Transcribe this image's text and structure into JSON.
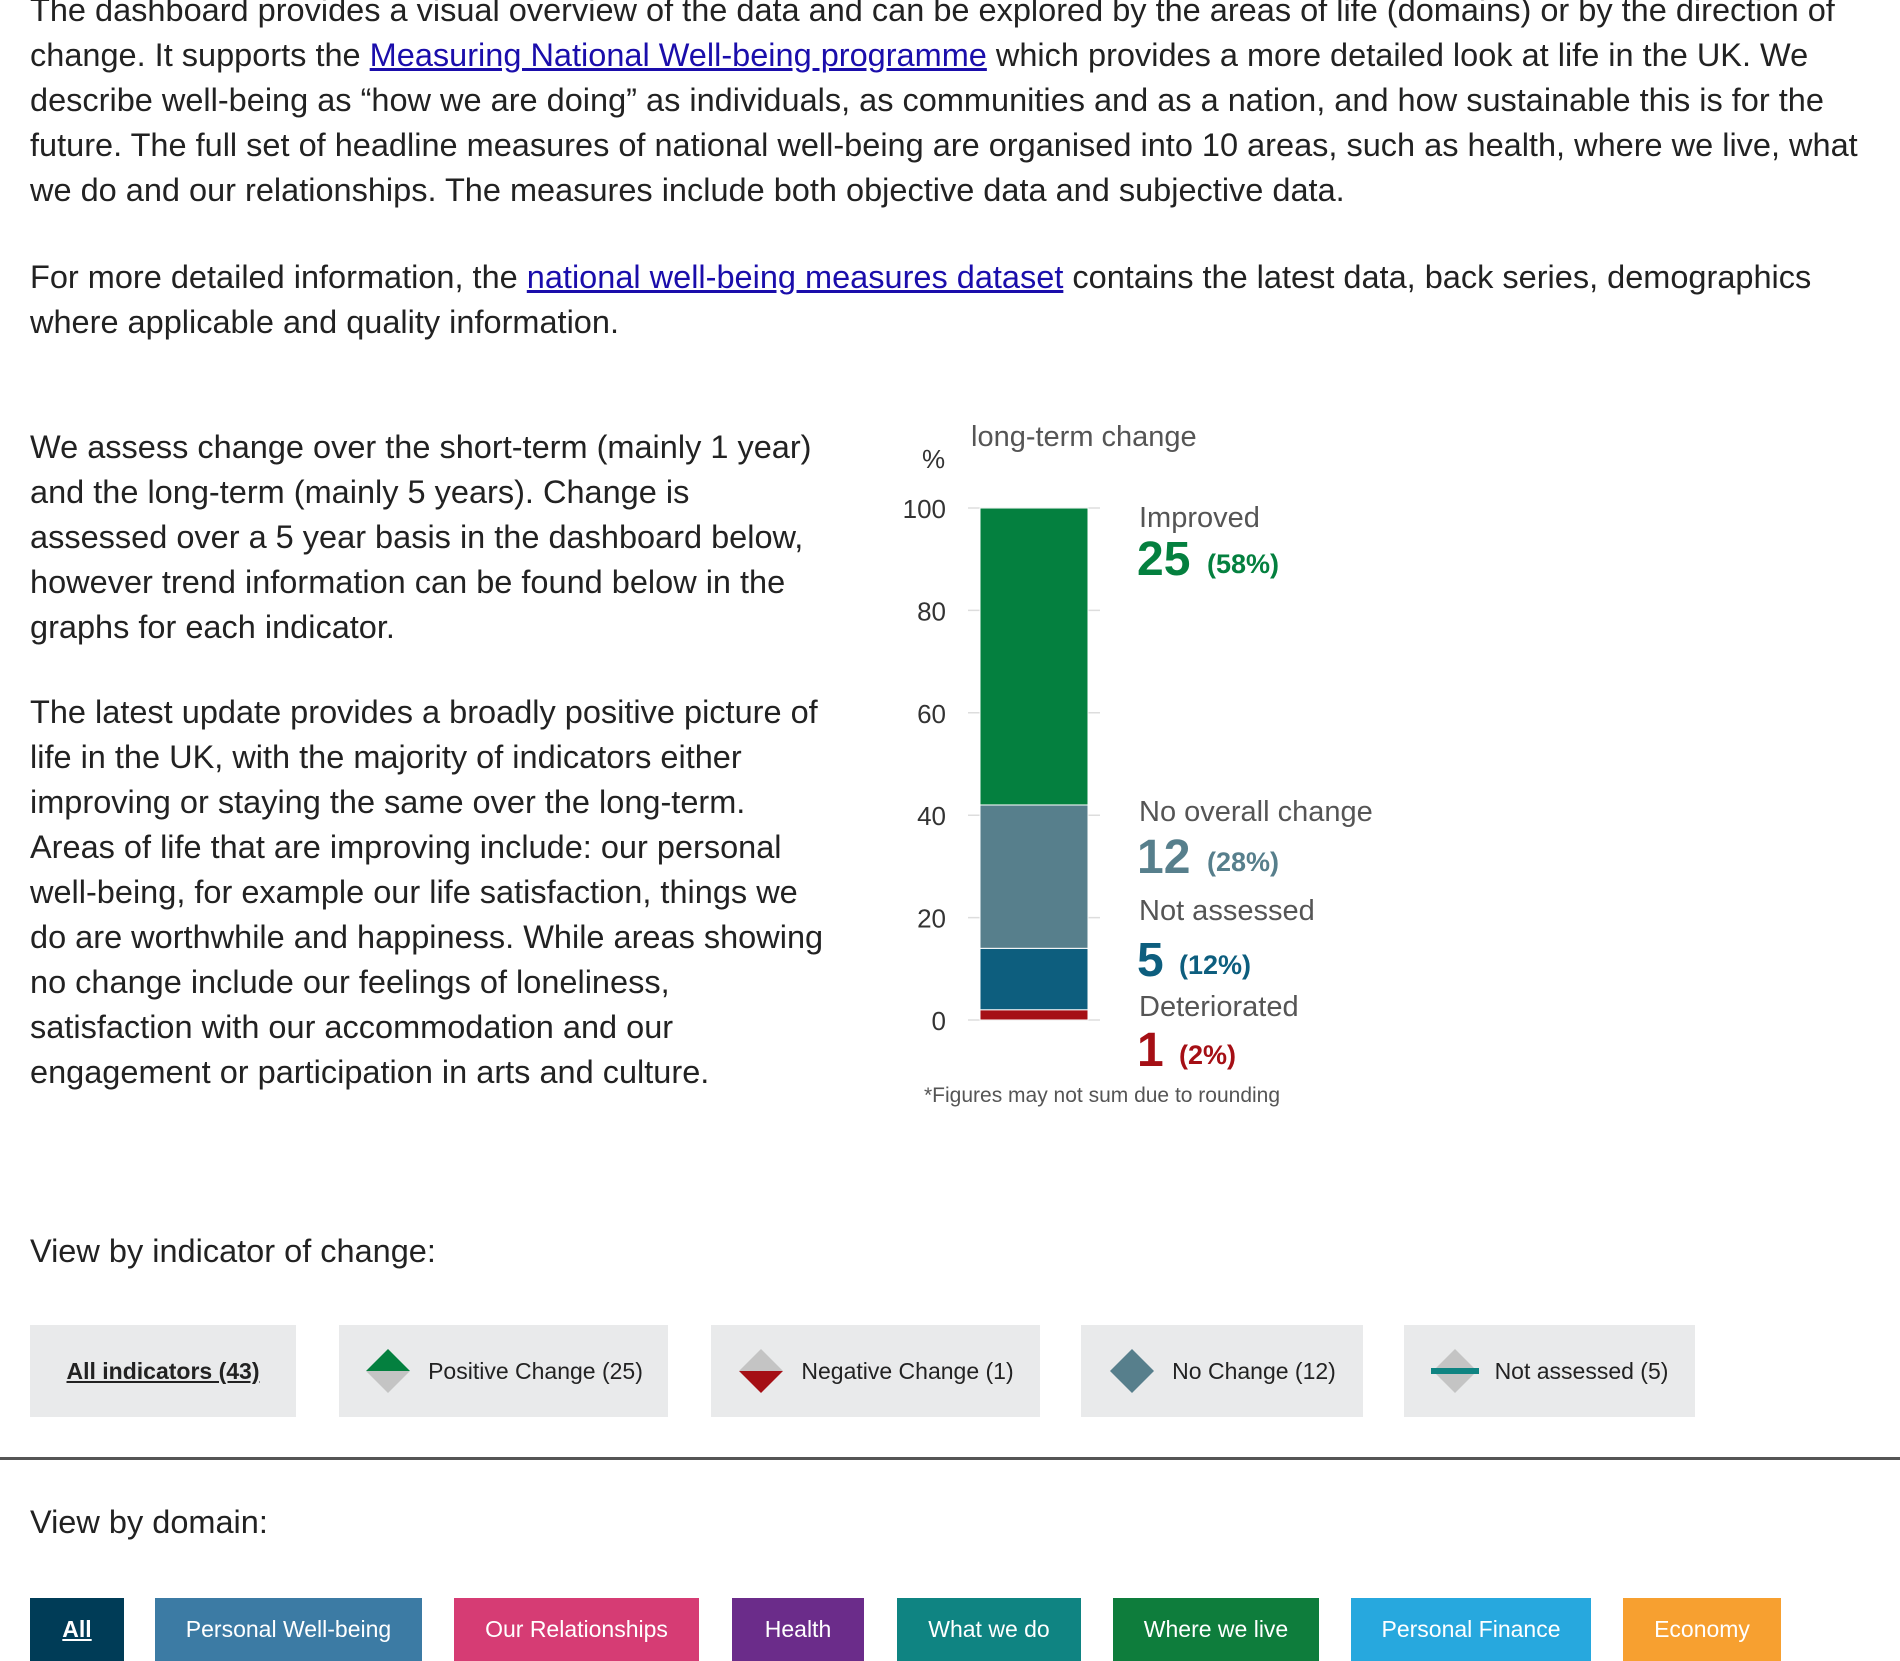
{
  "intro": {
    "p1_a": "The dashboard provides a visual overview of the data and can be explored by the areas of life (domains) or by the direction of change. It supports the ",
    "p1_link": "Measuring National Well-being programme",
    "p1_b": " which provides a more detailed look at life in the UK. We describe well-being as “how we are doing” as individuals, as communities and as a nation, and how sustainable this is for the future. The full set of headline measures of national well-being are organised into 10 areas, such as health, where we live, what we do and our relationships. The measures include both objective data and subjective data.",
    "p2_a": "For more detailed information, the ",
    "p2_link": "national well-being measures dataset",
    "p2_b": " contains the latest data, back series, demographics where applicable and quality information."
  },
  "summary": {
    "p1": "We assess change over the short-term (mainly 1 year) and the long-term (mainly 5 years). Change is assessed over a 5 year basis in the dashboard below, however trend information can be found below in the graphs for each indicator.",
    "p2": "The latest update provides a broadly positive picture of life in the UK, with the majority of indicators either improving or staying the same over the long-term. Areas of life that are improving include: our personal well-being, for example our life satisfaction, things we do are worthwhile and happiness. While areas showing no change include our feelings of loneliness, satisfaction with our accommodation and our engagement or participation in arts and culture."
  },
  "chart_data": {
    "type": "bar",
    "title": "long-term change",
    "ylabel": "%",
    "ylim": [
      0,
      100
    ],
    "yticks": [
      "0",
      "20",
      "40",
      "60",
      "80",
      "100"
    ],
    "series": [
      {
        "name": "Deteriorated",
        "count": "1",
        "pct": "(2%)",
        "value": 2,
        "color": "#a50f15"
      },
      {
        "name": "Not assessed",
        "count": "5",
        "pct": "(12%)",
        "value": 12,
        "color": "#0d5e7e"
      },
      {
        "name": "No overall change",
        "count": "12",
        "pct": "(28%)",
        "value": 28,
        "color": "#577f8c"
      },
      {
        "name": "Improved",
        "count": "25",
        "pct": "(58%)",
        "value": 58,
        "color": "#04803f"
      }
    ],
    "footnote": "*Figures may not sum due to rounding"
  },
  "change_filter": {
    "label": "View by indicator of change:",
    "buttons": [
      {
        "label": "All indicators (43)",
        "icon": "none",
        "active": true
      },
      {
        "label": "Positive Change (25)",
        "icon": "positive-change-icon"
      },
      {
        "label": "Negative Change (1)",
        "icon": "negative-change-icon"
      },
      {
        "label": "No Change (12)",
        "icon": "no-change-icon"
      },
      {
        "label": "Not assessed (5)",
        "icon": "not-assessed-icon"
      }
    ]
  },
  "domain_filter": {
    "label": "View by domain:",
    "buttons": [
      {
        "label": "All",
        "color": "#003c57",
        "active": true
      },
      {
        "label": "Personal Well-being",
        "color": "#3c7ba4"
      },
      {
        "label": "Our Relationships",
        "color": "#d63c74"
      },
      {
        "label": "Health",
        "color": "#6b2c8a"
      },
      {
        "label": "What we do",
        "color": "#0f8482"
      },
      {
        "label": "Where we live",
        "color": "#0e7d3c"
      },
      {
        "label": "Personal Finance",
        "color": "#27a8de"
      },
      {
        "label": "Economy",
        "color": "#f7a030"
      }
    ]
  }
}
